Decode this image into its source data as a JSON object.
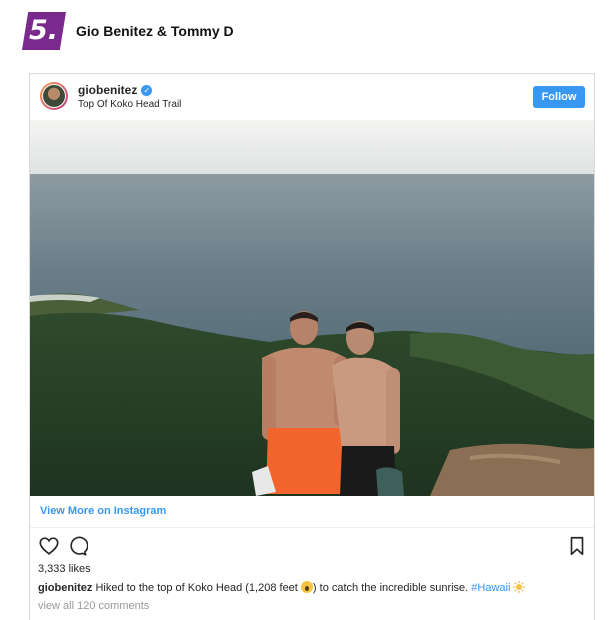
{
  "article": {
    "rank": "5.",
    "title": "Gio Benitez & Tommy D"
  },
  "post": {
    "username": "giobenitez",
    "location": "Top Of Koko Head Trail",
    "follow_label": "Follow",
    "view_more_label": "View More on Instagram",
    "likes": "3,333 likes",
    "caption": {
      "username": "giobenitez",
      "text_part1": " Hiked to the top of Koko Head (1,208 feet ",
      "text_part2": ") to catch the incredible sunrise. ",
      "hashtag": "#Hawaii"
    },
    "comments_link": "view all 120 comments"
  },
  "icons": {
    "like": "heart-icon",
    "comment": "comment-icon",
    "save": "bookmark-icon",
    "verified": "verified-badge-icon"
  },
  "colors": {
    "accent_purple": "#7a2a8c",
    "instagram_blue": "#3897f0"
  }
}
